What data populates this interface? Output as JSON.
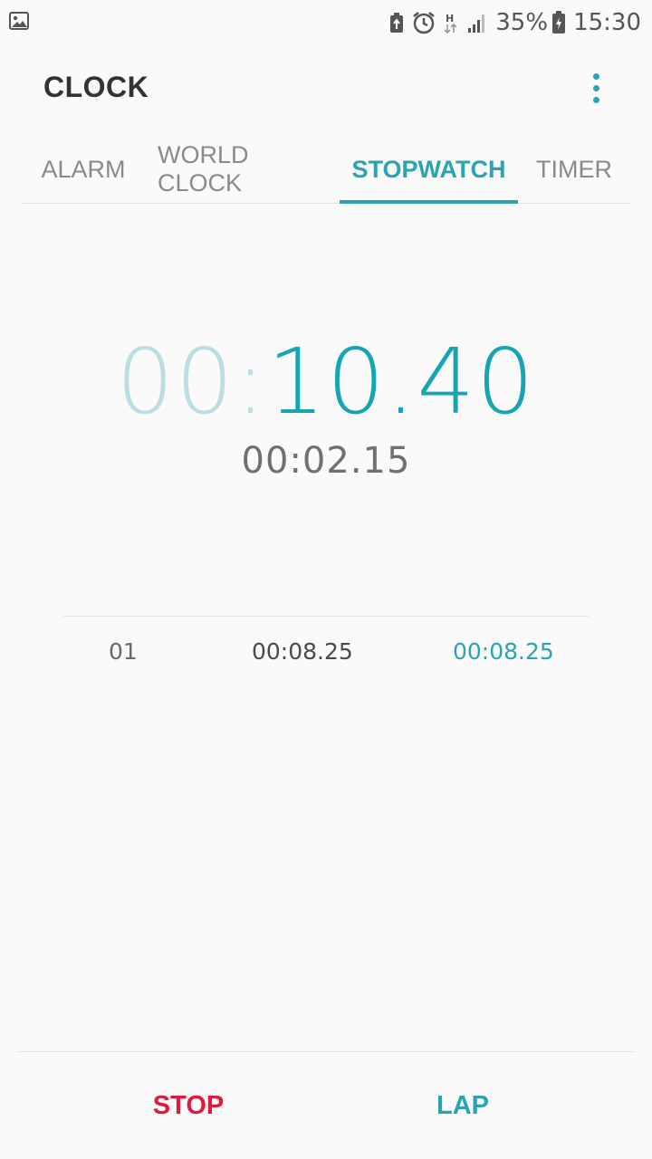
{
  "status_bar": {
    "battery_percent": "35%",
    "time": "15:30",
    "network_type": "H",
    "icons": [
      "gallery-icon",
      "battery-saver-icon",
      "alarm-icon",
      "network-h-icon",
      "signal-icon",
      "battery-charging-icon"
    ]
  },
  "header": {
    "title": "CLOCK",
    "more_icon": "more-vert-icon"
  },
  "tabs": [
    {
      "label": "ALARM",
      "active": false
    },
    {
      "label": "WORLD CLOCK",
      "active": false
    },
    {
      "label": "STOPWATCH",
      "active": true
    },
    {
      "label": "TIMER",
      "active": false
    }
  ],
  "stopwatch": {
    "minutes": "00",
    "colon": ":",
    "seconds": "10.40",
    "current_lap_time": "00:02.15"
  },
  "laps": [
    {
      "number": "01",
      "split": "00:08.25",
      "total": "00:08.25"
    }
  ],
  "buttons": {
    "stop_label": "STOP",
    "lap_label": "LAP"
  },
  "colors": {
    "accent": "#2aa3b2",
    "stop": "#e0193f",
    "background": "#fafafa"
  }
}
